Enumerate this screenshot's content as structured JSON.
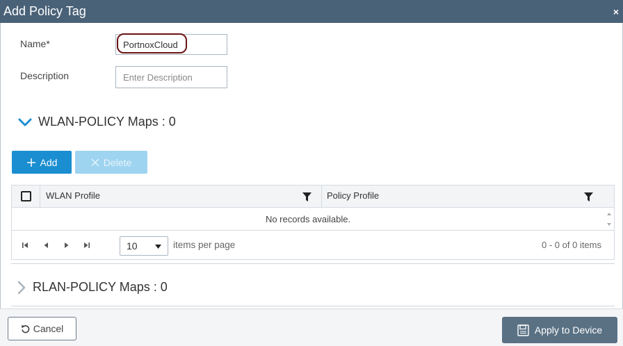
{
  "dialog": {
    "title": "Add Policy Tag",
    "close_glyph": "×"
  },
  "form": {
    "name_label": "Name*",
    "name_value": "PortnoxCloud",
    "description_label": "Description",
    "description_placeholder": "Enter Description"
  },
  "wlan_section": {
    "title": "WLAN-POLICY Maps : 0",
    "expanded": true,
    "add_label": "Add",
    "delete_label": "Delete",
    "columns": [
      "WLAN Profile",
      "Policy Profile"
    ],
    "empty_text": "No records available.",
    "page_size": "10",
    "items_per_page_label": "items per page",
    "range_text": "0 - 0 of 0 items"
  },
  "rlan_section": {
    "title": "RLAN-POLICY Maps : 0",
    "expanded": false
  },
  "footer": {
    "cancel_label": "Cancel",
    "apply_label": "Apply to Device"
  },
  "colors": {
    "titlebar": "#4a6278",
    "accent": "#1b8ed1",
    "highlight": "#6b1414",
    "apply_button": "#5a7184"
  }
}
